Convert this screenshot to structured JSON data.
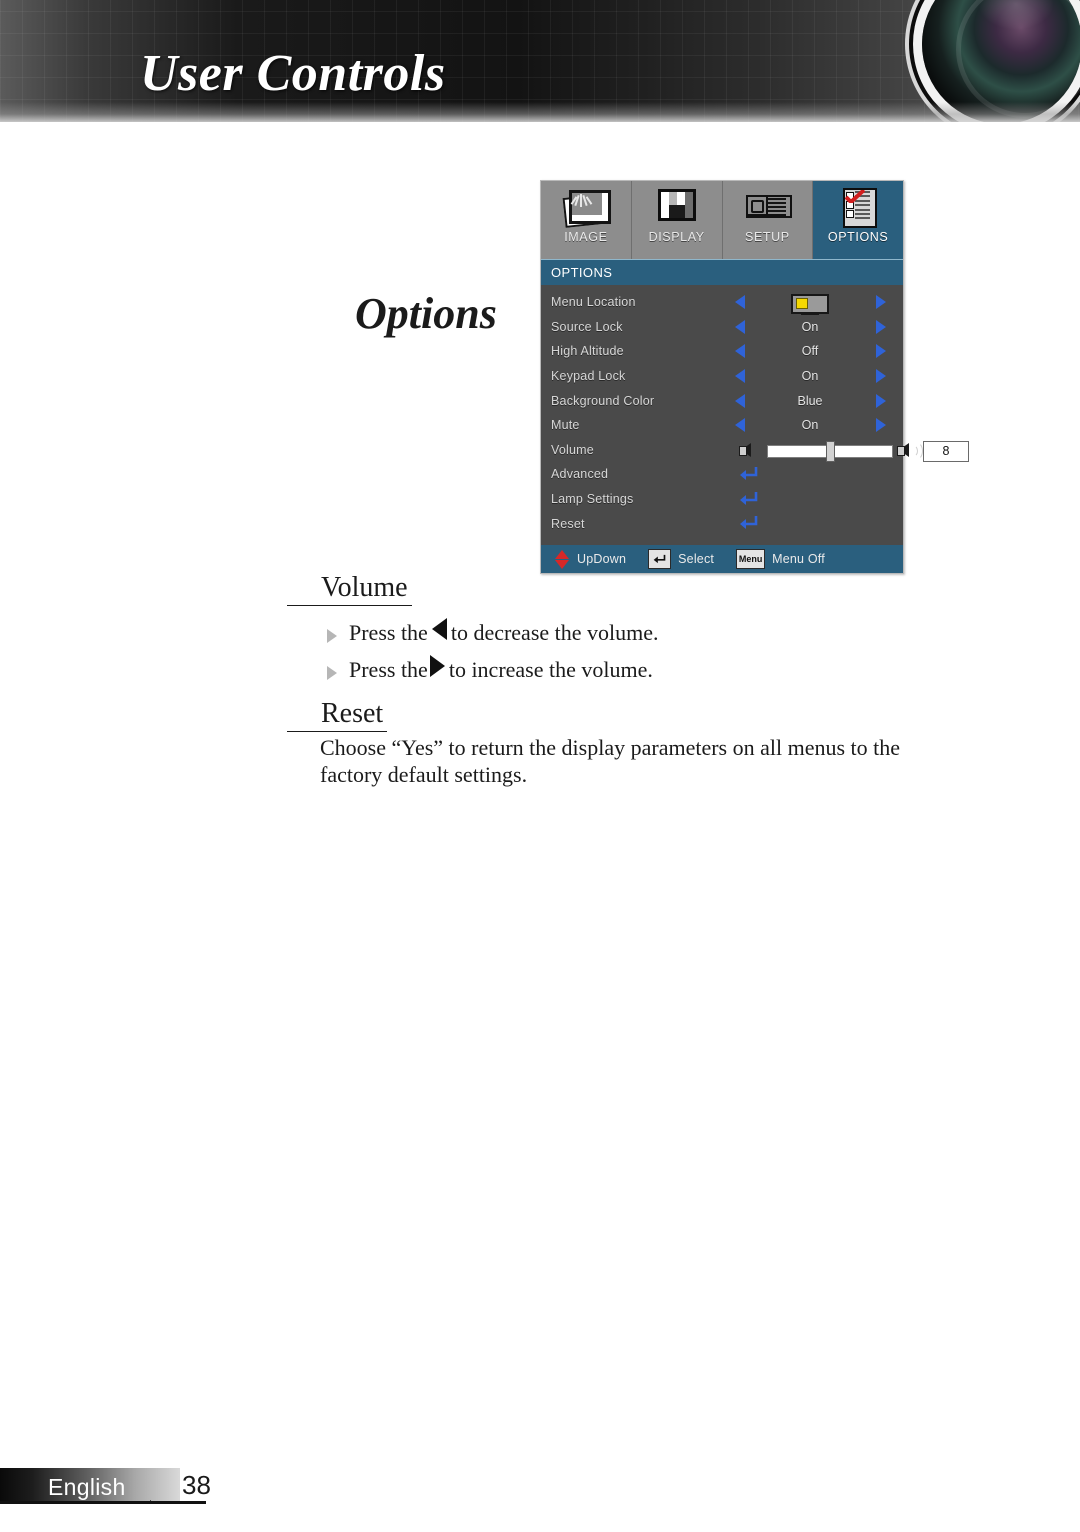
{
  "header": {
    "title": "User Controls",
    "lens_icon": "projector-lens-photo"
  },
  "document": {
    "section_title": "Options",
    "sections": [
      {
        "heading": "Volume",
        "bullets": [
          {
            "before": "Press the",
            "icon": "left-triangle-icon",
            "after": "to decrease the volume."
          },
          {
            "before": "Press the",
            "icon": "right-triangle-icon",
            "after": "to increase the volume."
          }
        ]
      },
      {
        "heading": "Reset",
        "paragraph_line1": "Choose “Yes” to return the display parameters on all menus to the",
        "paragraph_line2": "factory default settings."
      }
    ]
  },
  "osd": {
    "tabs": [
      {
        "label": "IMAGE",
        "icon": "image-icon",
        "active": false
      },
      {
        "label": "DISPLAY",
        "icon": "display-icon",
        "active": false
      },
      {
        "label": "SETUP",
        "icon": "setup-icon",
        "active": false
      },
      {
        "label": "OPTIONS",
        "icon": "options-icon",
        "active": true
      }
    ],
    "header_label": "OPTIONS",
    "rows": [
      {
        "label": "Menu Location",
        "type": "icon-select",
        "value": "",
        "icon": "menu-location-icon"
      },
      {
        "label": "Source Lock",
        "type": "select",
        "value": "On"
      },
      {
        "label": "High Altitude",
        "type": "select",
        "value": "Off"
      },
      {
        "label": "Keypad Lock",
        "type": "select",
        "value": "On"
      },
      {
        "label": "Background Color",
        "type": "select",
        "value": "Blue"
      },
      {
        "label": "Mute",
        "type": "select",
        "value": "On"
      },
      {
        "label": "Volume",
        "type": "slider",
        "value": "8",
        "slider_percent": 48
      },
      {
        "label": "Advanced",
        "type": "submenu",
        "value": ""
      },
      {
        "label": "Lamp Settings",
        "type": "submenu",
        "value": ""
      },
      {
        "label": "Reset",
        "type": "submenu",
        "value": ""
      }
    ],
    "footer": [
      {
        "label": "UpDown",
        "icon": "updown-arrows-icon"
      },
      {
        "label": "Select",
        "icon": "enter-key-icon"
      },
      {
        "label": "Menu Off",
        "icon": "menu-key-icon",
        "key_text": "Menu"
      }
    ],
    "colors": {
      "accent_blue": "#2a5f7e",
      "panel_gray": "#4a4a4a",
      "tab_gray": "#8d8d8d",
      "arrow_blue": "#2f63d8"
    }
  },
  "footer": {
    "language": "English",
    "page_number": "38"
  }
}
